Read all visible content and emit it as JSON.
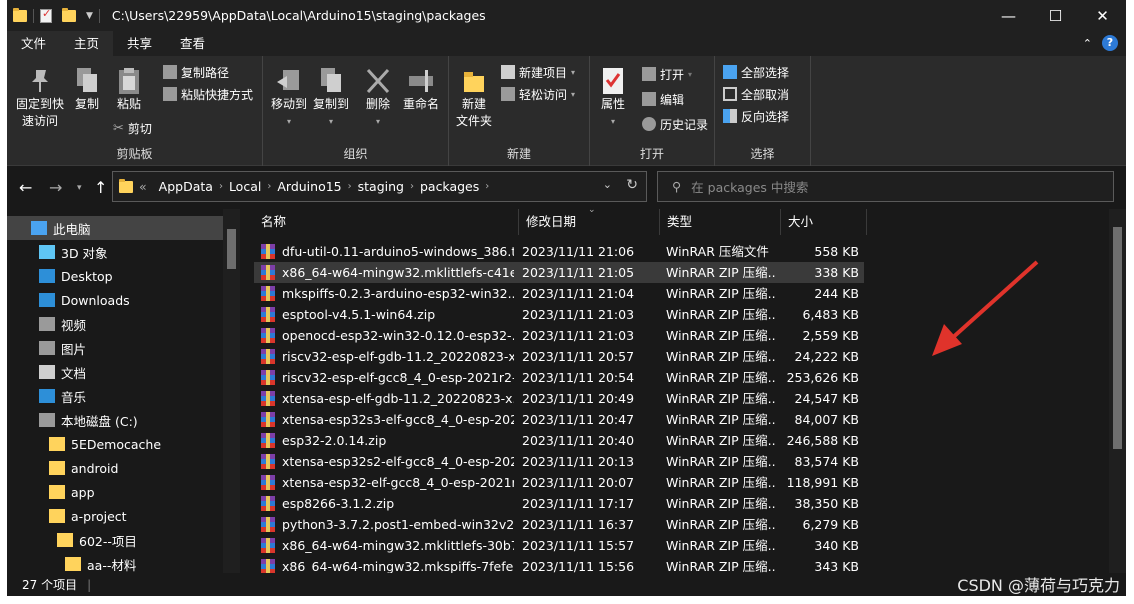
{
  "titlebar": {
    "path": "C:\\Users\\22959\\AppData\\Local\\Arduino15\\staging\\packages"
  },
  "window_buttons": {
    "minimize": "—",
    "maximize": "☐",
    "close": "✕"
  },
  "tabs": [
    {
      "label": "文件"
    },
    {
      "label": "主页"
    },
    {
      "label": "共享"
    },
    {
      "label": "查看"
    }
  ],
  "ribbon": {
    "clipboard": {
      "label": "剪贴板",
      "pin": "固定到快\n速访问",
      "copy": "复制",
      "paste": "粘贴",
      "copy_path": "复制路径",
      "paste_shortcut": "粘贴快捷方式",
      "cut": "剪切"
    },
    "organize": {
      "label": "组织",
      "move_to": "移动到",
      "copy_to": "复制到",
      "delete": "删除",
      "rename": "重命名"
    },
    "new": {
      "label": "新建",
      "new_folder": "新建\n文件夹",
      "new_item": "新建项目",
      "easy_access": "轻松访问"
    },
    "open": {
      "label": "打开",
      "properties": "属性",
      "open": "打开",
      "edit": "编辑",
      "history": "历史记录"
    },
    "select": {
      "label": "选择",
      "select_all": "全部选择",
      "select_none": "全部取消",
      "invert": "反向选择"
    }
  },
  "address": {
    "crumbs": [
      "«",
      "AppData",
      "Local",
      "Arduino15",
      "staging",
      "packages"
    ]
  },
  "search": {
    "placeholder": "在 packages 中搜索"
  },
  "nav": [
    {
      "label": "此电脑",
      "icon": "pc-icon",
      "indent": 0,
      "selected": true
    },
    {
      "label": "3D 对象",
      "icon": "3d-objects-icon",
      "indent": 1
    },
    {
      "label": "Desktop",
      "icon": "desktop-icon",
      "indent": 1
    },
    {
      "label": "Downloads",
      "icon": "download-icon",
      "indent": 1
    },
    {
      "label": "视频",
      "icon": "video-icon",
      "indent": 1
    },
    {
      "label": "图片",
      "icon": "pictures-icon",
      "indent": 1
    },
    {
      "label": "文档",
      "icon": "documents-icon",
      "indent": 1
    },
    {
      "label": "音乐",
      "icon": "music-icon",
      "indent": 1
    },
    {
      "label": "本地磁盘 (C:)",
      "icon": "drive-icon",
      "indent": 1
    },
    {
      "label": "5EDemocache",
      "icon": "folder-icon",
      "indent": 2
    },
    {
      "label": "android",
      "icon": "folder-icon",
      "indent": 2
    },
    {
      "label": "app",
      "icon": "folder-icon",
      "indent": 2
    },
    {
      "label": "a-project",
      "icon": "folder-icon",
      "indent": 2
    },
    {
      "label": "602--项目",
      "icon": "folder-icon",
      "indent": 3
    },
    {
      "label": "aa--材料",
      "icon": "folder-icon",
      "indent": 4
    }
  ],
  "columns": {
    "name": "名称",
    "modified": "修改日期",
    "type": "类型",
    "size": "大小"
  },
  "files": [
    {
      "name": "dfu-util-0.11-arduino5-windows_386.t...",
      "date": "2023/11/11 21:06",
      "type": "WinRAR 压缩文件",
      "size": "558 KB"
    },
    {
      "name": "x86_64-w64-mingw32.mklittlefs-c41e...",
      "date": "2023/11/11 21:05",
      "type": "WinRAR ZIP 压缩...",
      "size": "338 KB",
      "selected": true
    },
    {
      "name": "mkspiffs-0.2.3-arduino-esp32-win32....",
      "date": "2023/11/11 21:04",
      "type": "WinRAR ZIP 压缩...",
      "size": "244 KB"
    },
    {
      "name": "esptool-v4.5.1-win64.zip",
      "date": "2023/11/11 21:03",
      "type": "WinRAR ZIP 压缩...",
      "size": "6,483 KB"
    },
    {
      "name": "openocd-esp32-win32-0.12.0-esp32-...",
      "date": "2023/11/11 21:03",
      "type": "WinRAR ZIP 压缩...",
      "size": "2,559 KB"
    },
    {
      "name": "riscv32-esp-elf-gdb-11.2_20220823-x...",
      "date": "2023/11/11 20:57",
      "type": "WinRAR ZIP 压缩...",
      "size": "24,222 KB"
    },
    {
      "name": "riscv32-esp-elf-gcc8_4_0-esp-2021r2-...",
      "date": "2023/11/11 20:54",
      "type": "WinRAR ZIP 压缩...",
      "size": "253,626 KB"
    },
    {
      "name": "xtensa-esp-elf-gdb-11.2_20220823-x...",
      "date": "2023/11/11 20:49",
      "type": "WinRAR ZIP 压缩...",
      "size": "24,547 KB"
    },
    {
      "name": "xtensa-esp32s3-elf-gcc8_4_0-esp-202...",
      "date": "2023/11/11 20:47",
      "type": "WinRAR ZIP 压缩...",
      "size": "84,007 KB"
    },
    {
      "name": "esp32-2.0.14.zip",
      "date": "2023/11/11 20:40",
      "type": "WinRAR ZIP 压缩...",
      "size": "246,588 KB"
    },
    {
      "name": "xtensa-esp32s2-elf-gcc8_4_0-esp-202...",
      "date": "2023/11/11 20:13",
      "type": "WinRAR ZIP 压缩...",
      "size": "83,574 KB"
    },
    {
      "name": "xtensa-esp32-elf-gcc8_4_0-esp-2021r...",
      "date": "2023/11/11 20:07",
      "type": "WinRAR ZIP 压缩...",
      "size": "118,991 KB"
    },
    {
      "name": "esp8266-3.1.2.zip",
      "date": "2023/11/11 17:17",
      "type": "WinRAR ZIP 压缩...",
      "size": "38,350 KB"
    },
    {
      "name": "python3-3.7.2.post1-embed-win32v2...",
      "date": "2023/11/11 16:37",
      "type": "WinRAR ZIP 压缩...",
      "size": "6,279 KB"
    },
    {
      "name": "x86_64-w64-mingw32.mklittlefs-30b7f...",
      "date": "2023/11/11 15:57",
      "type": "WinRAR ZIP 压缩...",
      "size": "340 KB"
    },
    {
      "name": "x86_64-w64-mingw32.mkspiffs-7fefea...",
      "date": "2023/11/11 15:56",
      "type": "WinRAR ZIP 压缩...",
      "size": "343 KB"
    }
  ],
  "status": {
    "count": "27 个项目"
  },
  "watermark": "CSDN @薄荷与巧克力",
  "colors": {
    "annotation_arrow": "#e0332b",
    "folder": "#ffd35c",
    "selection": "#3a3a3a"
  }
}
